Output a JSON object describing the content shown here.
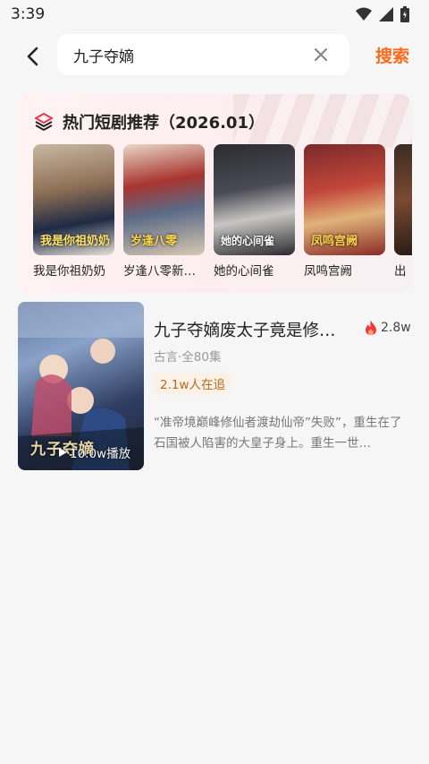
{
  "status_bar": {
    "time": "3:39"
  },
  "search": {
    "query": "九子夺嫡",
    "submit_label": "搜索"
  },
  "hot_section": {
    "title": "热门短剧推荐（2026.01）",
    "items": [
      {
        "title": "我是你祖奶奶",
        "poster_text": "我是你祖奶奶"
      },
      {
        "title": "岁逢八零新…",
        "poster_text": "岁逢八零"
      },
      {
        "title": "她的心间雀",
        "poster_text": "她的心间雀"
      },
      {
        "title": "凤鸣宫阙",
        "poster_text": "凤鸣宫阙"
      },
      {
        "title": "出",
        "poster_text": ""
      }
    ]
  },
  "result": {
    "title": "九子夺嫡废太子竟是修…",
    "heat": "2.8w",
    "meta": "古言·全80集",
    "badge": "2.1w人在追",
    "plays": "10.0w播放",
    "cover_text": "九子夺嫡",
    "description": "“准帝境巅峰修仙者渡劫仙帝”失败”，重生在了石国被人陷害的大皇子身上。重生一世…"
  },
  "colors": {
    "accent": "#ff6a1a",
    "badge_text": "#b36b1f",
    "badge_bg": "#fbf1e6"
  }
}
